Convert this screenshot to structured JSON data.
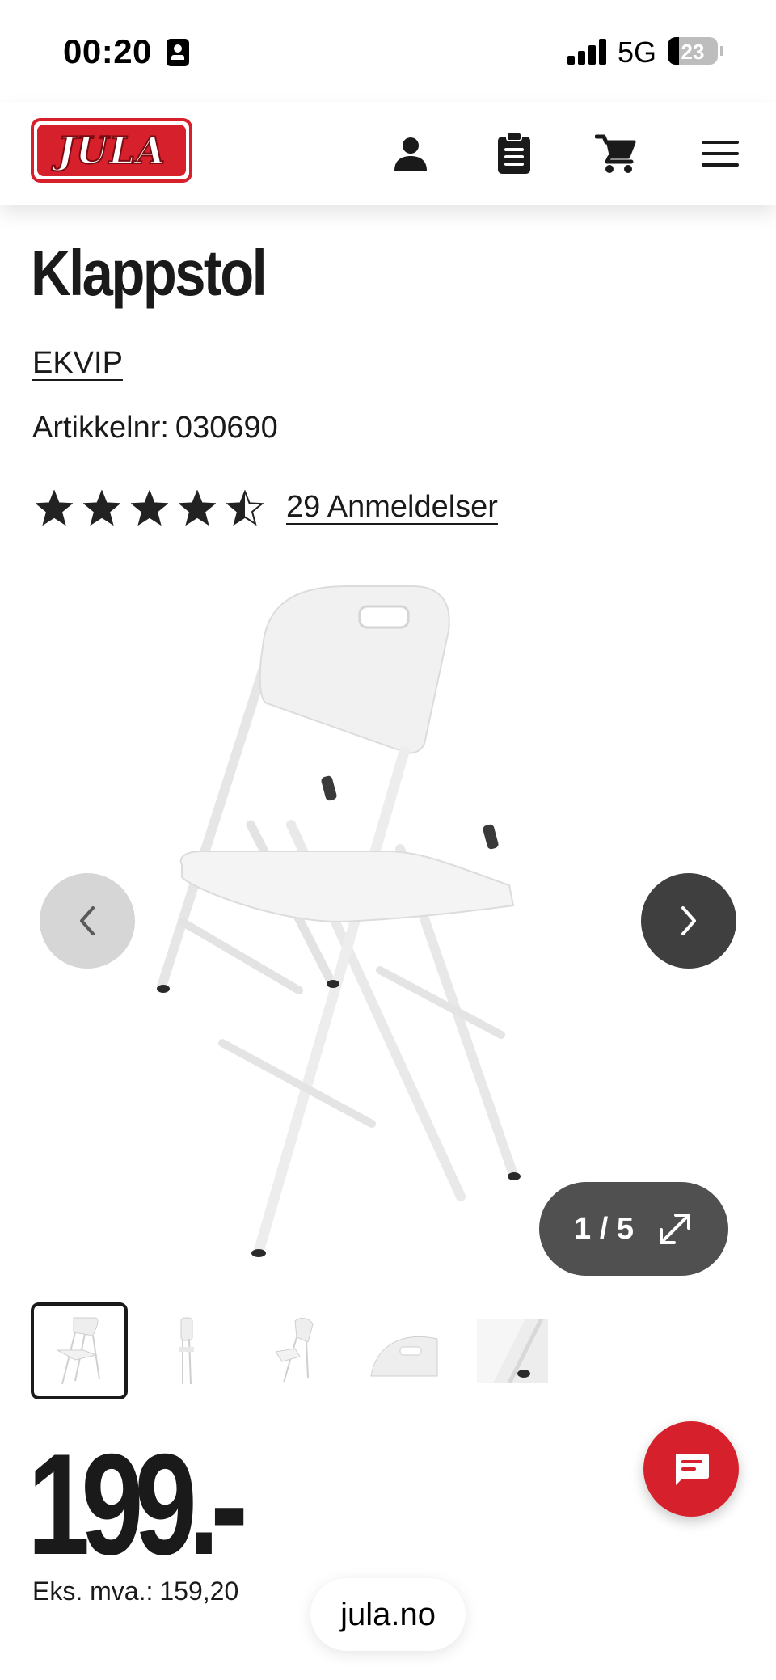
{
  "status_bar": {
    "time": "00:20",
    "network": "5G",
    "battery": "23",
    "battery_level": 0.23
  },
  "header": {
    "logo_text": "JULA",
    "icons": [
      "user-icon",
      "clipboard-icon",
      "cart-icon",
      "menu-icon"
    ]
  },
  "product": {
    "title": "Klappstol",
    "brand": "EKVIP",
    "article_label": "Artikkelnr:",
    "article_number": "030690",
    "rating": 4.5,
    "rating_max": 5,
    "reviews_label": "29 Anmeldelser"
  },
  "gallery": {
    "counter": "1 / 5",
    "thumbnail_count": 5,
    "active_index": 0
  },
  "price": {
    "value": "199.-",
    "vat_label": "Eks. mva.:",
    "vat_value": "159,20"
  },
  "browser": {
    "url": "jula.no"
  },
  "colors": {
    "brand_red": "#d6202b",
    "text": "#1a1a1a",
    "dark_button": "#3f3f3f",
    "light_button": "#d6d6d6",
    "counter_bg": "#505050"
  }
}
